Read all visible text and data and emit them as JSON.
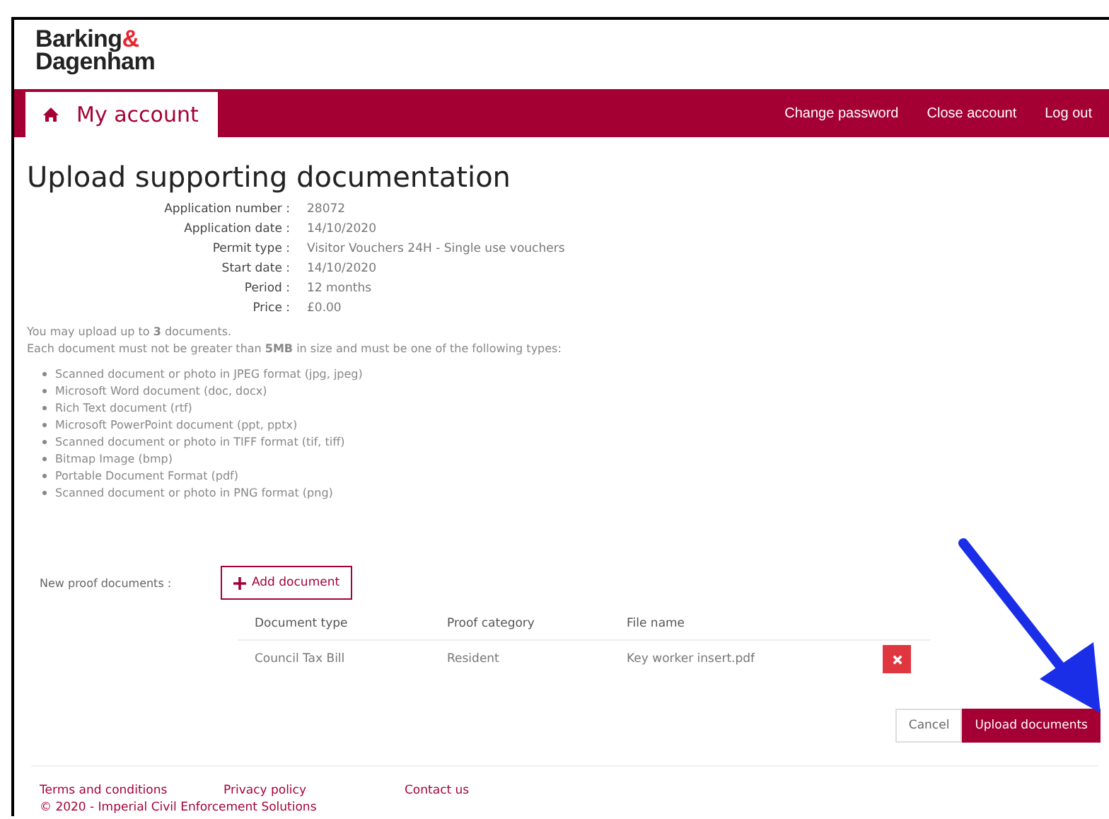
{
  "logo": {
    "line1": "Barking",
    "ampersand": "&",
    "line2": "Dagenham"
  },
  "nav": {
    "home": "My account",
    "links": [
      "Change password",
      "Close account",
      "Log out"
    ]
  },
  "title": "Upload supporting documentation",
  "details": [
    {
      "label": "Application number :",
      "value": "28072"
    },
    {
      "label": "Application date :",
      "value": "14/10/2020"
    },
    {
      "label": "Permit type :",
      "value": "Visitor Vouchers 24H - Single use vouchers"
    },
    {
      "label": "Start date :",
      "value": "14/10/2020"
    },
    {
      "label": "Period :",
      "value": "12 months"
    },
    {
      "label": "Price :",
      "value": "£0.00"
    }
  ],
  "intro": [
    "You may upload up to **3** documents.",
    "Each document must not be greater than **5MB** in size and must be one of the following types:"
  ],
  "file_types": [
    "Scanned document or photo in JPEG format (jpg, jpeg)",
    "Microsoft Word document (doc, docx)",
    "Rich Text document (rtf)",
    "Microsoft PowerPoint document (ppt, pptx)",
    "Scanned document or photo in TIFF format (tif, tiff)",
    "Bitmap Image (bmp)",
    "Portable Document Format (pdf)",
    "Scanned document or photo in PNG format (png)"
  ],
  "proof": {
    "label": "New proof documents :",
    "add_button": "Add document",
    "columns": [
      "Document type",
      "Proof category",
      "File name"
    ],
    "rows": [
      {
        "document_type": "Council Tax Bill",
        "proof_category": "Resident",
        "file_name": "Key worker insert.pdf"
      }
    ]
  },
  "buttons": {
    "cancel": "Cancel",
    "upload": "Upload documents"
  },
  "footer": {
    "links": [
      "Terms and conditions",
      "Privacy policy",
      "Contact us"
    ],
    "copyright": "© 2020 - Imperial Civil Enforcement Solutions"
  }
}
